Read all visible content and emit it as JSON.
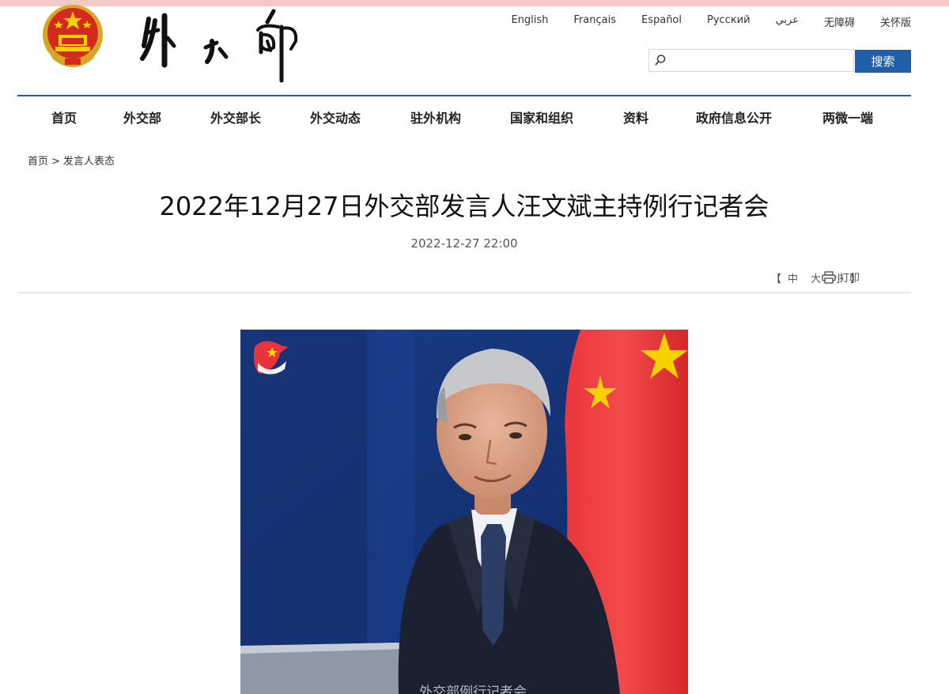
{
  "header": {
    "languages": [
      "English",
      "Français",
      "Español",
      "Русский",
      "عربي",
      "无障碍",
      "关怀版"
    ],
    "search": {
      "placeholder": "",
      "button_label": "搜索"
    }
  },
  "nav": {
    "items": [
      "首页",
      "外交部",
      "外交部长",
      "外交动态",
      "驻外机构",
      "国家和组织",
      "资料",
      "政府信息公开",
      "两微一端"
    ]
  },
  "breadcrumb": {
    "home": "首页",
    "separator": ">",
    "current": "发言人表态"
  },
  "article": {
    "title": "2022年12月27日外交部发言人汪文斌主持例行记者会",
    "date": "2022-12-27 22:00",
    "font_size": {
      "open": "【",
      "medium": "中",
      "large": "大",
      "small": "小",
      "close": "】"
    },
    "print_label": "打印",
    "photo_caption": "外交部例行记者会"
  },
  "colors": {
    "brand_blue": "#1f5fa8",
    "flag_red": "#e8343a",
    "flag_gold": "#f6d100",
    "backdrop_blue": "#1b3a7a"
  },
  "icons": {
    "search": "search-icon",
    "print": "printer-icon",
    "emblem": "national-emblem-icon"
  }
}
